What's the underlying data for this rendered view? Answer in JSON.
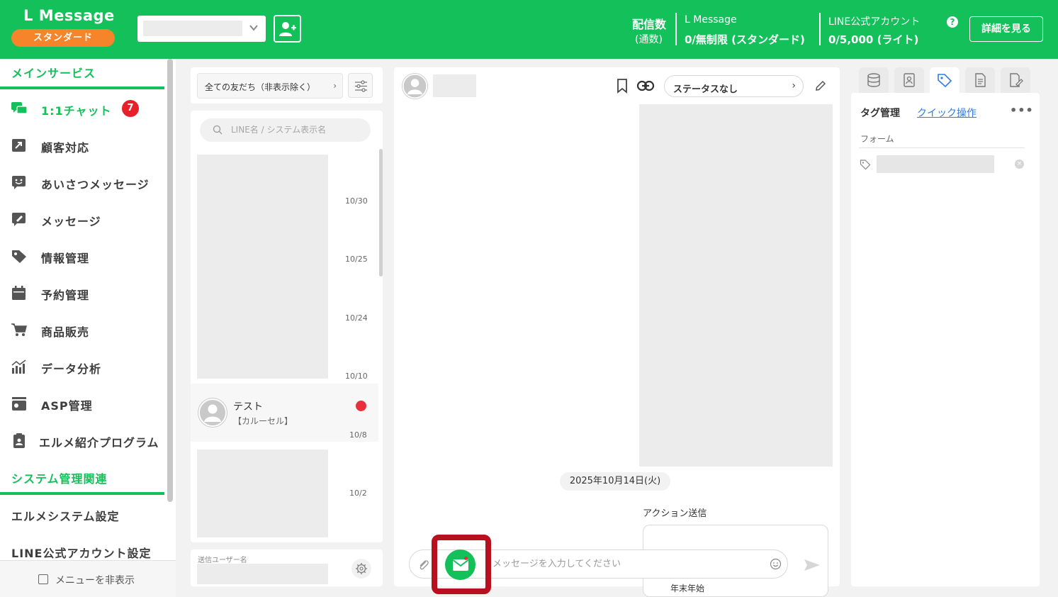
{
  "header": {
    "logo": "L Message",
    "plan": "スタンダード",
    "delivery_label": "配信数",
    "delivery_sub": "(通数)",
    "app_name": "L Message",
    "app_quota": "0/無制限 (スタンダード)",
    "line_label": "LINE公式アカウント",
    "line_quota": "0/5,000 (ライト)",
    "help": "?",
    "detail_button": "詳細を見る",
    "colors": {
      "brand": "#14c05a",
      "plan_badge": "#f5842a"
    }
  },
  "sidebar": {
    "main_section": "メインサービス",
    "items": [
      {
        "label": "1:1チャット",
        "icon": "chat-bubbles-icon",
        "badge": "7",
        "active": true
      },
      {
        "label": "顧客対応",
        "icon": "arrow-box-icon"
      },
      {
        "label": "あいさつメッセージ",
        "icon": "smile-bubble-icon"
      },
      {
        "label": "メッセージ",
        "icon": "pen-bubble-icon"
      },
      {
        "label": "情報管理",
        "icon": "tag-icon"
      },
      {
        "label": "予約管理",
        "icon": "calendar-icon"
      },
      {
        "label": "商品販売",
        "icon": "cart-icon"
      },
      {
        "label": "データ分析",
        "icon": "chart-icon"
      },
      {
        "label": "ASP管理",
        "icon": "asp-box-icon"
      },
      {
        "label": "エルメ紹介プログラム",
        "icon": "clipboard-user-icon"
      }
    ],
    "system_section": "システム管理関連",
    "system_items": [
      "エルメシステム設定",
      "LINE公式アカウント設定"
    ],
    "hide_menu": "メニューを非表示"
  },
  "friends": {
    "filter": "全ての友だち（非表示除く）",
    "filter_chevron": "›",
    "search_placeholder": "LINE名 / システム表示名",
    "dates": [
      "10/30",
      "10/25",
      "10/24",
      "10/10",
      "10/8",
      "10/2"
    ],
    "selected": {
      "name": "テスト",
      "message": "【カルーセル】"
    },
    "sender_label": "送信ユーザー名"
  },
  "chat": {
    "status": "ステータスなし",
    "status_chevron": "›",
    "date": "2025年10月14日(火)",
    "action_label": "アクション送信",
    "card_text": "年末年始",
    "input_placeholder": "メッセージを入力してください"
  },
  "right_panel": {
    "tabs": [
      "database-icon",
      "contact-card-icon",
      "tag-icon",
      "document-icon",
      "document-edit-icon"
    ],
    "tag_title": "タグ管理",
    "quick_link": "クイック操作",
    "more": "•••",
    "form_label": "フォーム",
    "remove": "×"
  }
}
